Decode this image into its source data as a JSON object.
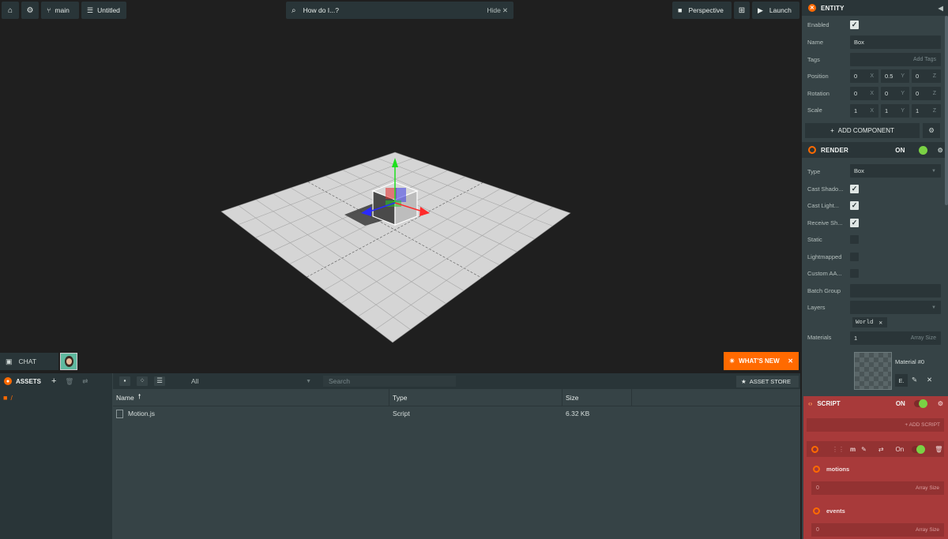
{
  "toolbar": {
    "branch": "main",
    "project": "Untitled",
    "search_placeholder": "How do I...?",
    "search_hide": "Hide",
    "camera": "Perspective",
    "launch": "Launch"
  },
  "viewport_overlay": {
    "chat": "CHAT",
    "whats_new": "WHAT'S NEW"
  },
  "entity": {
    "header": "ENTITY",
    "enabled_label": "Enabled",
    "name_label": "Name",
    "name_value": "Box",
    "tags_label": "Tags",
    "tags_placeholder": "Add Tags",
    "position_label": "Position",
    "position": [
      "0",
      "0.5",
      "0"
    ],
    "rotation_label": "Rotation",
    "rotation": [
      "0",
      "0",
      "0"
    ],
    "scale_label": "Scale",
    "scale": [
      "1",
      "1",
      "1"
    ],
    "axis": [
      "X",
      "Y",
      "Z"
    ],
    "add_component": "ADD COMPONENT"
  },
  "render": {
    "header": "RENDER",
    "on_label": "ON",
    "type_label": "Type",
    "type_value": "Box",
    "cast_shadows": "Cast Shado...",
    "cast_lightmap": "Cast Light...",
    "receive_shadows": "Receive Sh...",
    "static": "Static",
    "lightmapped": "Lightmapped",
    "custom_aabb": "Custom AA...",
    "batch_group": "Batch Group",
    "layers_label": "Layers",
    "layer_tag": "World",
    "materials_label": "Materials",
    "materials_count": "1",
    "array_size": "Array Size",
    "material_name": "Material #0",
    "material_e": "E."
  },
  "script": {
    "header": "SCRIPT",
    "on_label": "ON",
    "add_script": "+ ADD SCRIPT",
    "item_name": "m",
    "item_on": "On",
    "attr1": "motions",
    "attr1_value": "0",
    "attr2": "events",
    "attr2_value": "0",
    "array_size": "Array Size"
  },
  "assets": {
    "header": "ASSETS",
    "root": "/",
    "filter": "All",
    "search_placeholder": "Search",
    "store": "ASSET STORE",
    "columns": [
      "Name",
      "Type",
      "Size"
    ],
    "rows": [
      {
        "name": "Motion.js",
        "type": "Script",
        "size": "6.32 KB"
      }
    ]
  },
  "colors": {
    "accent": "#ff6a00",
    "panel": "#364346",
    "panel_dark": "#293538",
    "script_bg": "#a83a3a",
    "toggle_on": "#7ad144"
  }
}
